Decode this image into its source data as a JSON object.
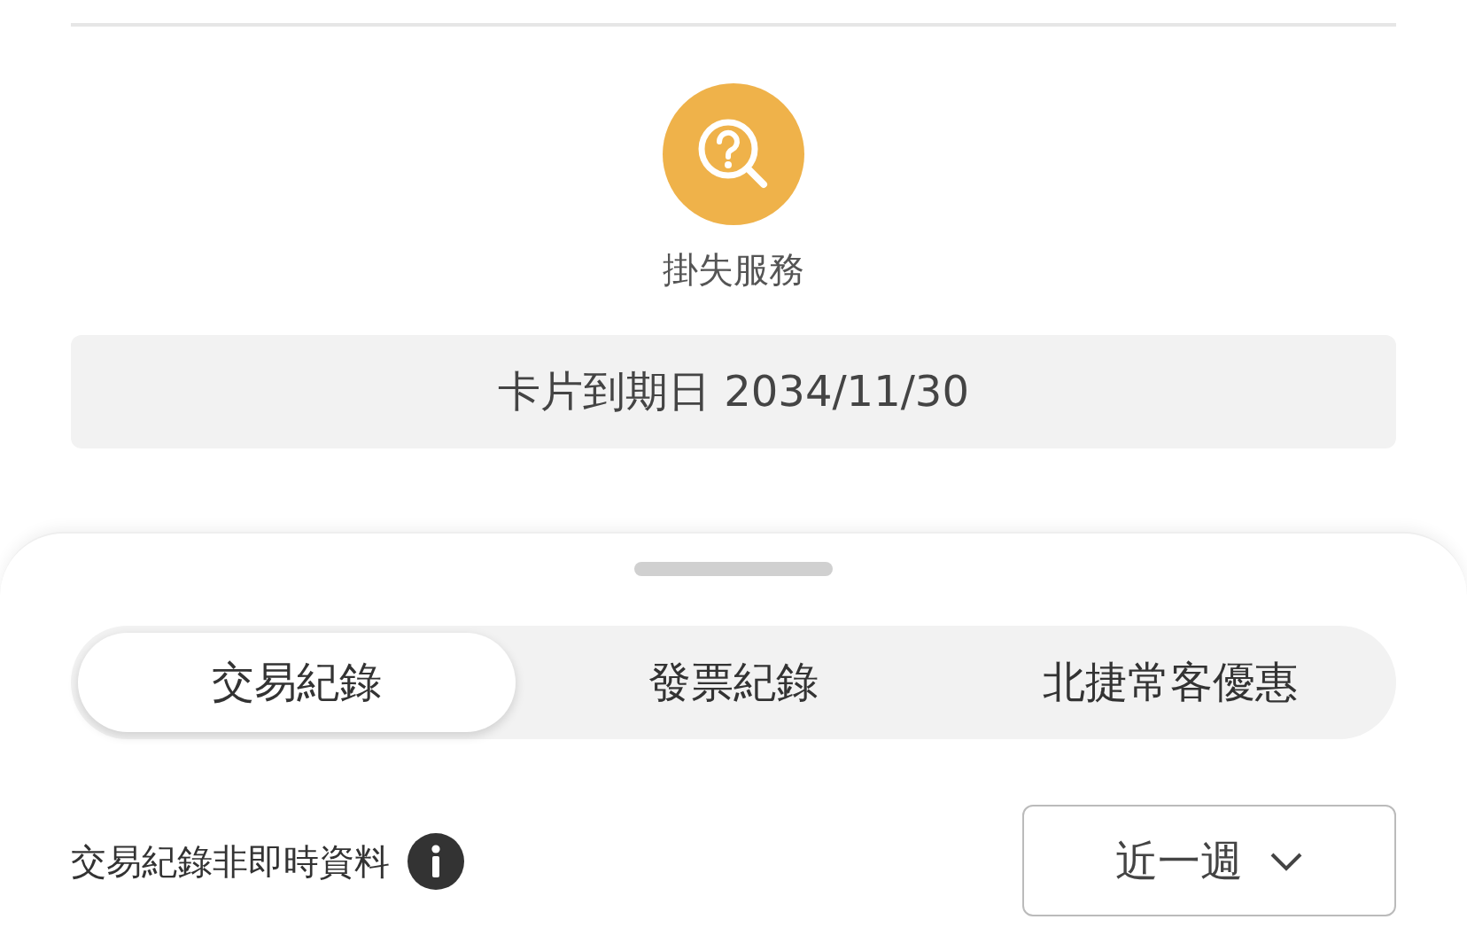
{
  "lost_service": {
    "label": "掛失服務"
  },
  "expiry": "卡片到期日 2034/11/30",
  "tabs": [
    {
      "label": "交易紀錄",
      "selected": true
    },
    {
      "label": "發票紀錄",
      "selected": false
    },
    {
      "label": "北捷常客優惠",
      "selected": false
    }
  ],
  "notice": "交易紀錄非即時資料",
  "period_select": {
    "value": "近一週"
  }
}
